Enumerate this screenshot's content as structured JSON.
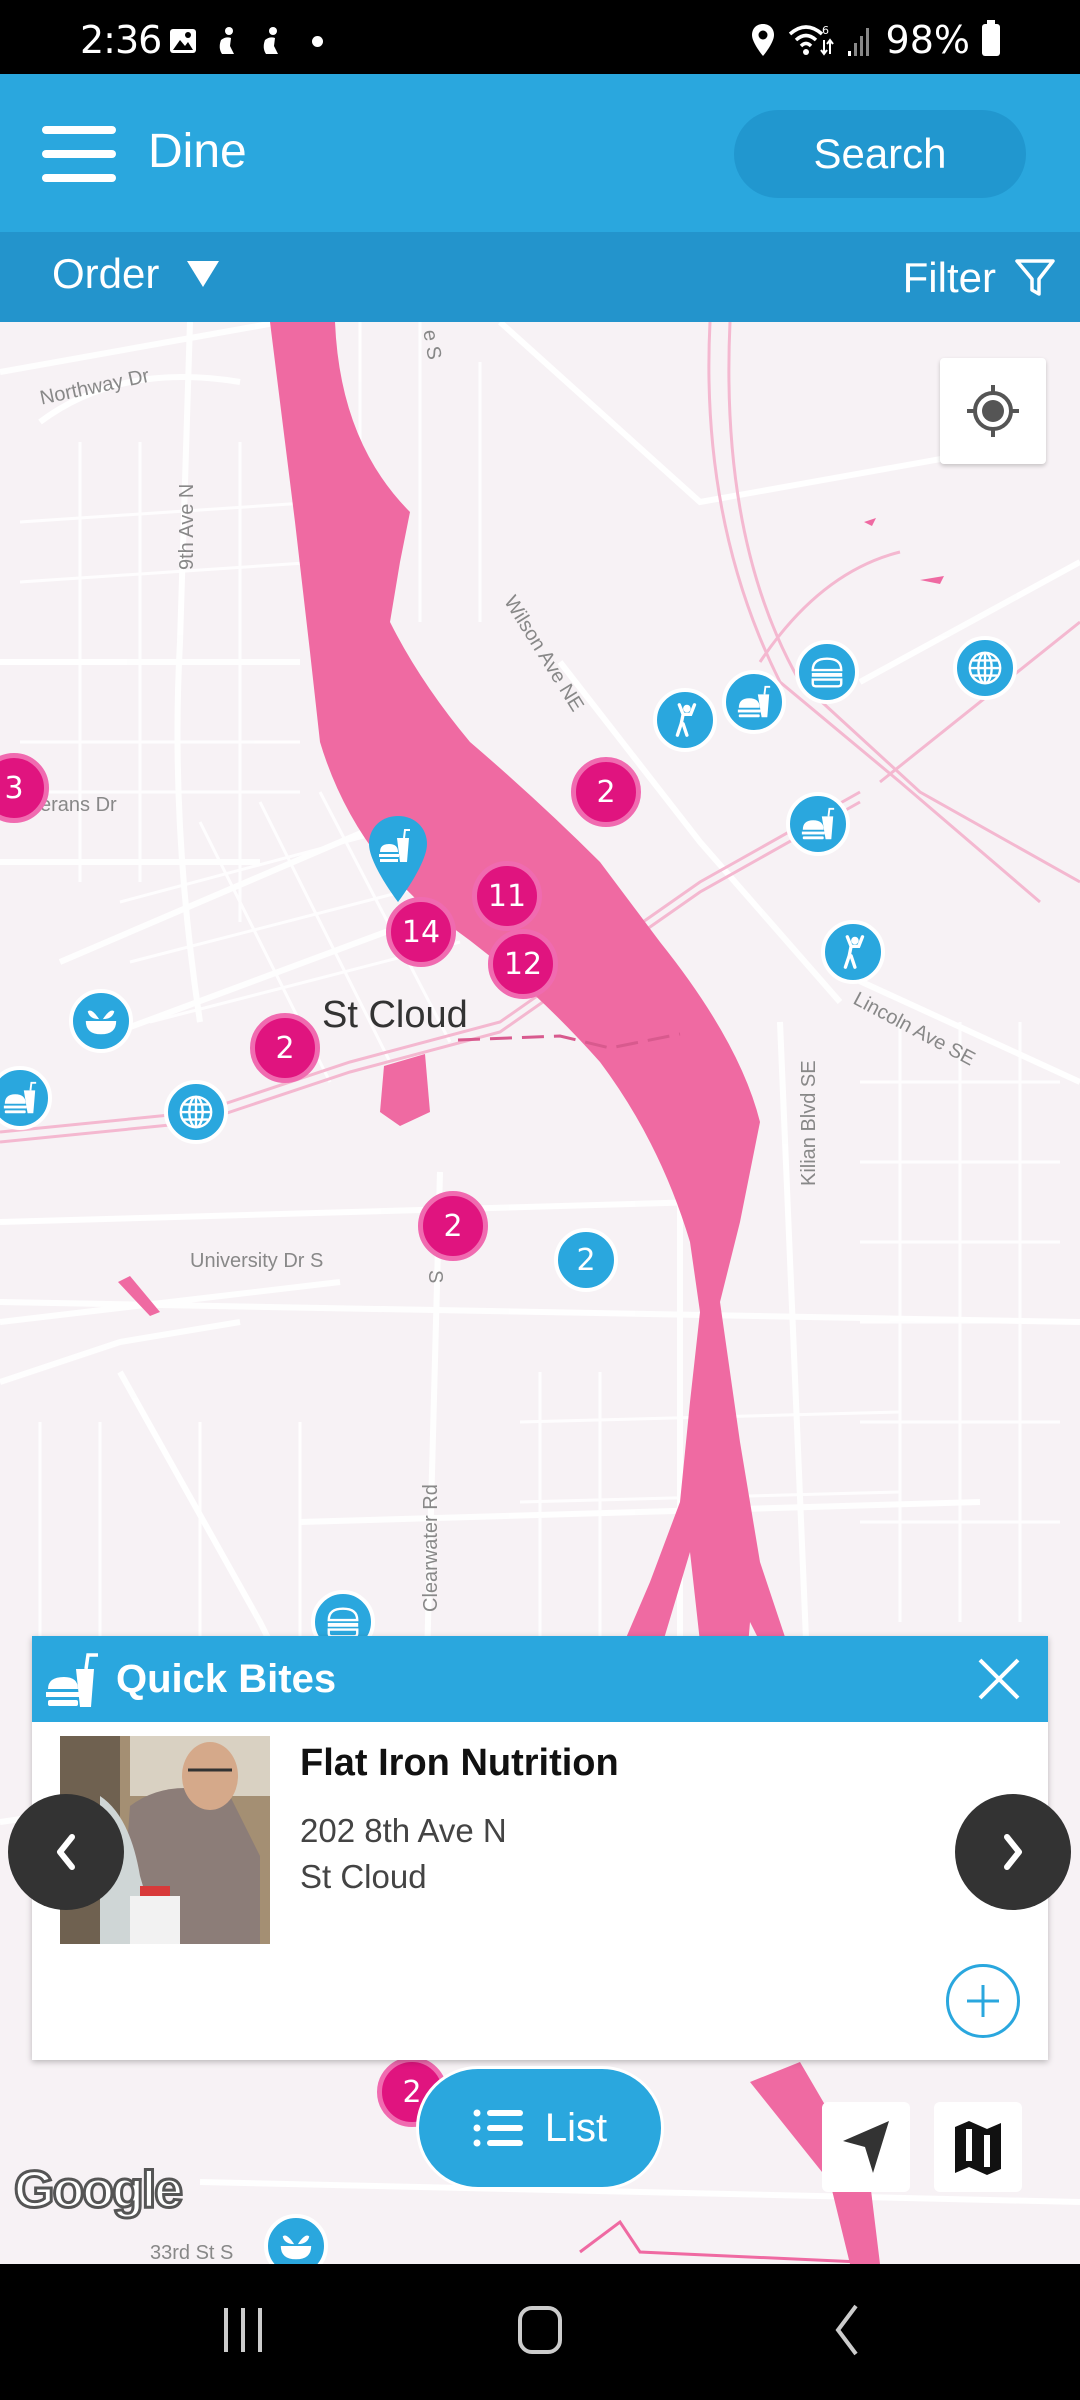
{
  "status_bar": {
    "time": "2:36",
    "battery": "98%",
    "left_icons": [
      "gallery-icon",
      "accessibility-icon",
      "accessibility-icon",
      "notification-dot"
    ],
    "right_icons": [
      "location-icon",
      "wifi-icon",
      "signal-icon",
      "battery-icon"
    ]
  },
  "header": {
    "title": "Dine",
    "search_label": "Search",
    "menu_icon": "hamburger-icon"
  },
  "toolbar": {
    "order_label": "Order",
    "filter_label": "Filter"
  },
  "map": {
    "city_label": "St Cloud",
    "street_labels": [
      "Northway Dr",
      "9th Ave N",
      "Wilson Ave NE",
      "erans Dr",
      "Lincoln Ave SE",
      "Kilian Blvd SE",
      "University Dr S",
      "Clearwater Rd",
      "33rd St S",
      "e S",
      "S"
    ],
    "clusters_pink": [
      "3",
      "2",
      "11",
      "14",
      "12",
      "2",
      "2",
      "2"
    ],
    "clusters_blue": [
      "2"
    ],
    "poi_icons": [
      "dance-icon",
      "fastfood-icon",
      "burger-icon",
      "globe-icon",
      "fastfood-icon",
      "dance-icon",
      "salad-bowl-icon",
      "fastfood-icon",
      "globe-icon",
      "burger-icon",
      "salad-bowl-icon"
    ],
    "attribution": "Google",
    "colors": {
      "water": "#ef6aa2",
      "cluster": "#e0147f",
      "poi": "#2aa7de"
    }
  },
  "card": {
    "category": "Quick Bites",
    "name": "Flat Iron Nutrition",
    "address_line1": "202 8th Ave N",
    "address_line2": "St Cloud"
  },
  "bottom": {
    "list_label": "List"
  },
  "colors": {
    "primary": "#2aa7de",
    "primary_dark": "#2394cc",
    "search_bg": "#2197cf"
  }
}
